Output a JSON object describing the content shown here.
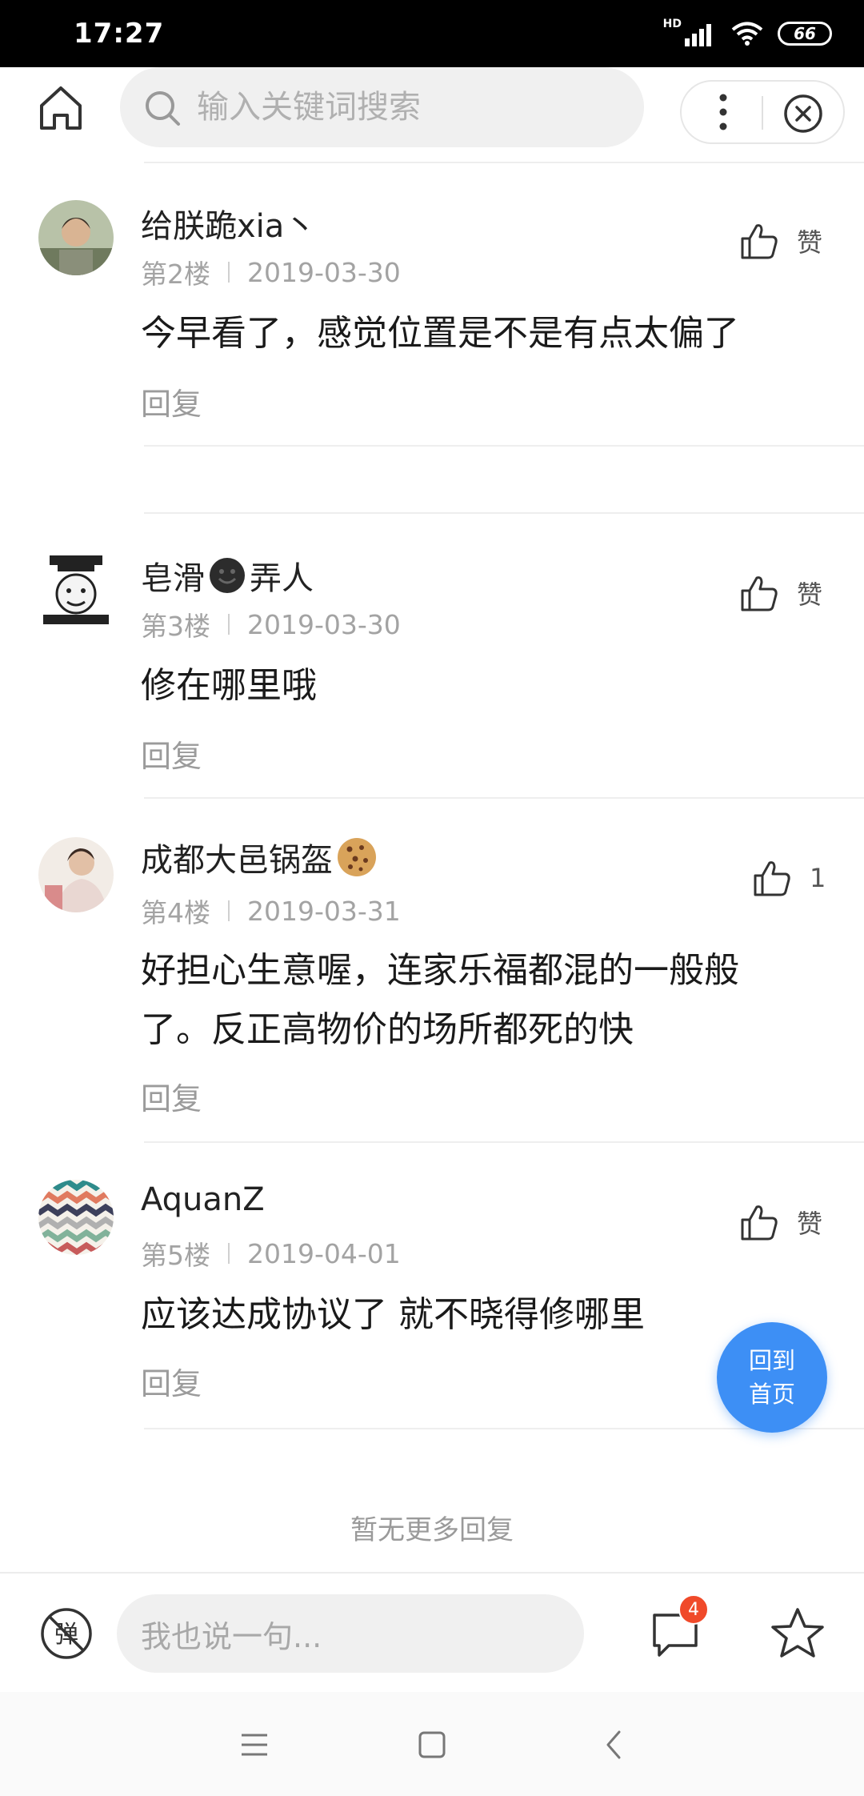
{
  "status_bar": {
    "time": "17:27",
    "network": "HD",
    "battery": "66"
  },
  "search": {
    "placeholder": "输入关键词搜索"
  },
  "comments": [
    {
      "username": "给朕跪xia丶",
      "floor": "第2楼",
      "date": "2019-03-30",
      "content": "今早看了，感觉位置是不是有点太偏了",
      "reply": "回复",
      "like": "赞"
    },
    {
      "username_a": "皂滑",
      "username_b": "弄人",
      "floor": "第3楼",
      "date": "2019-03-30",
      "content": "修在哪里哦",
      "reply": "回复",
      "like": "赞"
    },
    {
      "username": "成都大邑锅盔",
      "floor": "第4楼",
      "date": "2019-03-31",
      "content": "好担心生意喔，连家乐福都混的一般般了。反正高物价的场所都死的快",
      "reply": "回复",
      "like": "1"
    },
    {
      "username": "AquanZ",
      "floor": "第5楼",
      "date": "2019-04-01",
      "content": "应该达成协议了 就不晓得修哪里",
      "reply": "回复",
      "like": "赞"
    }
  ],
  "no_more": "暂无更多回复",
  "back_home": {
    "line1": "回到",
    "line2": "首页"
  },
  "bottom_bar": {
    "input_placeholder": "我也说一句...",
    "comment_count": "4",
    "danmu_glyph": "弹"
  },
  "colors": {
    "accent": "#3d8ff5",
    "badge": "#f04a2a"
  }
}
